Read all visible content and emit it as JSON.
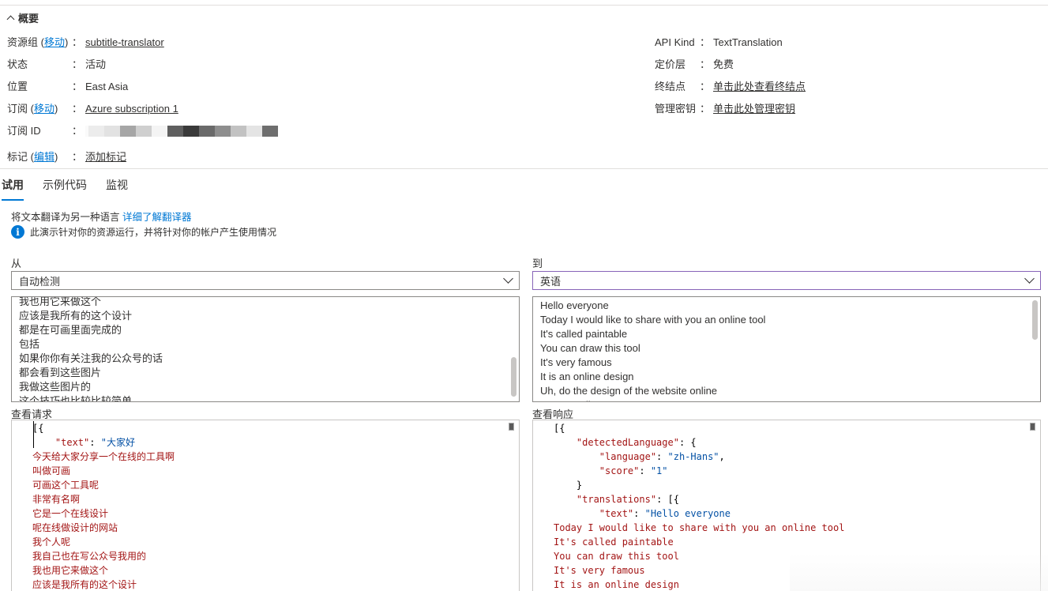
{
  "overview": {
    "title": "概要"
  },
  "props_left": {
    "resource_group": {
      "key": "资源组",
      "move": "移动",
      "value": "subtitle-translator"
    },
    "status": {
      "key": "状态",
      "value": "活动"
    },
    "location": {
      "key": "位置",
      "value": "East Asia"
    },
    "subscription": {
      "key": "订阅",
      "move": "移动",
      "value": "Azure subscription 1"
    },
    "subscription_id": {
      "key": "订阅 ID"
    },
    "tags": {
      "key": "标记",
      "edit": "编辑",
      "value": "添加标记"
    }
  },
  "props_right": {
    "api_kind": {
      "key": "API Kind",
      "value": "TextTranslation"
    },
    "pricing": {
      "key": "定价层",
      "value": "免费"
    },
    "endpoint": {
      "key": "终结点",
      "value": "单击此处查看终结点"
    },
    "keys": {
      "key": "管理密钥",
      "value": "单击此处管理密钥"
    }
  },
  "separator": "：",
  "tabs": [
    "试用",
    "示例代码",
    "监视"
  ],
  "tryout": {
    "desc": "将文本翻译为另一种语言",
    "desc_link": "详细了解翻译器",
    "info": "此演示针对你的资源运行，并将针对你的帐户产生使用情况"
  },
  "from": {
    "label": "从",
    "selected": "自动检测"
  },
  "to": {
    "label": "到",
    "selected": "英语"
  },
  "source_text": "我也用它来做这个\n应该是我所有的这个设计\n都是在可画里面完成的\n包括\n如果你你有关注我的公众号的话\n都会看到这些图片\n我做这些图片的\n这个技巧也比较比较简单",
  "translated_text": "Hello everyone\nToday I would like to share with you an online tool\nIt's called paintable\nYou can draw this tool\nIt's very famous\nIt is an online design\nUh, do the design of the website online\nI, personally",
  "request": {
    "label": "查看请求",
    "line1": "[{",
    "key": "\"text\"",
    "colon": ": ",
    "first": "\"大家好",
    "rest": "今天给大家分享一个在线的工具啊\n叫做可画\n可画这个工具呢\n非常有名啊\n它是一个在线设计\n呢在线做设计的网站\n我个人呢\n我自己也在写公众号我用的\n我也用它来做这个\n应该是我所有的这个设计"
  },
  "response": {
    "label": "查看响应",
    "line1": "[{",
    "detected_key": "\"detectedLanguage\"",
    "lang_key": "\"language\"",
    "lang_val": "\"zh-Hans\"",
    "score_key": "\"score\"",
    "score_val": "\"1\"",
    "close": "}",
    "translations_key": "\"translations\"",
    "text_key": "\"text\"",
    "first": "\"Hello everyone",
    "rest": "Today I would like to share with you an online tool\nIt's called paintable\nYou can draw this tool\nIt's very famous\nIt is an online design"
  },
  "colors": {
    "link": "#0078d4",
    "select_focus": "#8764b8",
    "json_key": "#a31515",
    "json_string": "#0451a5"
  }
}
